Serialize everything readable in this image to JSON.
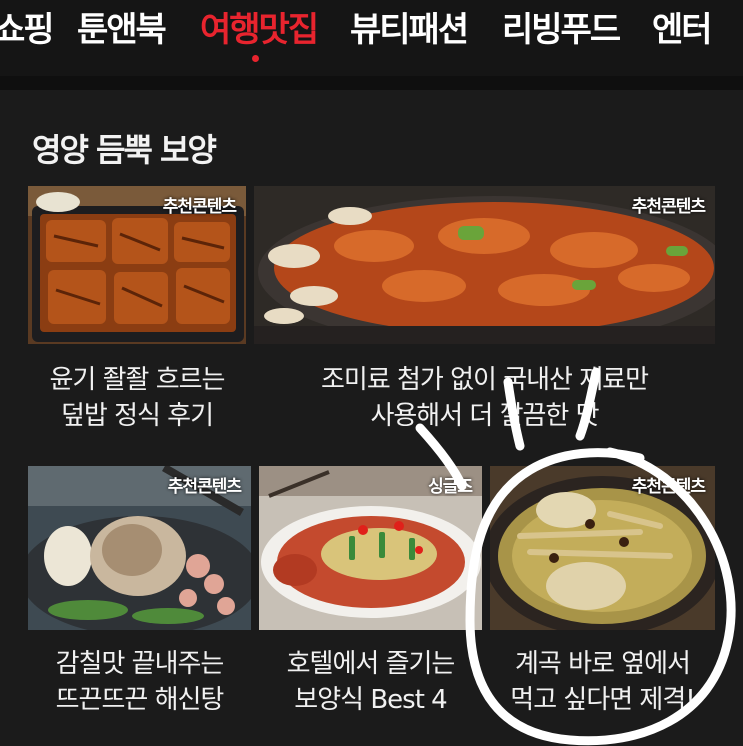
{
  "tabs": [
    {
      "label": "쇼핑",
      "active": false
    },
    {
      "label": "툰앤북",
      "active": false
    },
    {
      "label": "여행맛집",
      "active": true
    },
    {
      "label": "뷰티패션",
      "active": false
    },
    {
      "label": "리빙푸드",
      "active": false
    },
    {
      "label": "엔터",
      "active": false
    }
  ],
  "accent_color": "#e8242e",
  "section": {
    "title": "영양 듬뿍 보양",
    "cards": [
      {
        "badge": "추천콘텐츠",
        "caption_line1": "윤기 좔좔 흐르는",
        "caption_line2": "덮밥 정식 후기",
        "image": "eel-rice-box-photo"
      },
      {
        "badge": "추천콘텐츠",
        "caption_line1": "조미료 첨가 없이 국내산 재료만",
        "caption_line2": "사용해서 더 깔끔한 맛",
        "image": "spicy-stir-fry-photo"
      },
      {
        "badge": "추천콘텐츠",
        "caption_line1": "감칠맛 끝내주는",
        "caption_line2": "뜨끈뜨끈 해신탕",
        "image": "seafood-chicken-soup-photo"
      },
      {
        "badge": "싱글즈",
        "caption_line1": "호텔에서 즐기는",
        "caption_line2": "보양식 Best 4",
        "image": "steamed-fish-dish-photo"
      },
      {
        "badge": "추천콘텐츠",
        "caption_line1": "계곡 바로 옆에서",
        "caption_line2": "먹고 싶다면 제격!",
        "image": "ginseng-chicken-soup-photo"
      }
    ]
  },
  "annotation": "hand-drawn-circle-scribble"
}
